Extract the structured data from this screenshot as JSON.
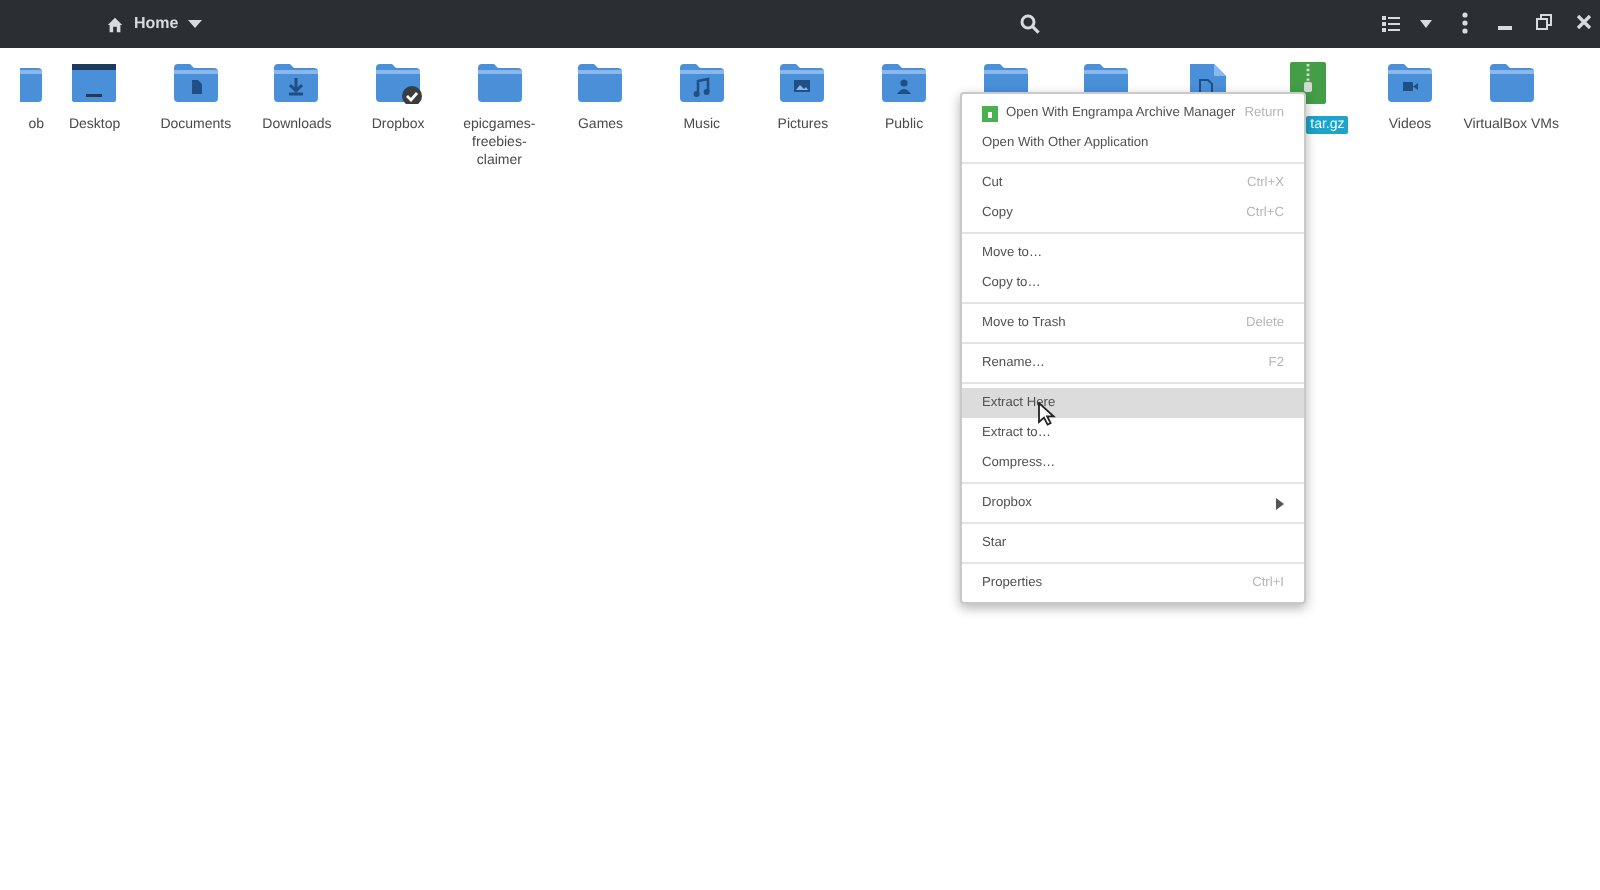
{
  "header": {
    "location": "Home"
  },
  "files": [
    {
      "name": "ob",
      "kind": "partial",
      "selected": false
    },
    {
      "name": "Desktop",
      "kind": "desktop",
      "selected": false
    },
    {
      "name": "Documents",
      "kind": "documents",
      "selected": false
    },
    {
      "name": "Downloads",
      "kind": "downloads",
      "selected": false
    },
    {
      "name": "Dropbox",
      "kind": "dropbox",
      "selected": false
    },
    {
      "name": "epicgames-freebies-claimer",
      "kind": "plain",
      "selected": false
    },
    {
      "name": "Games",
      "kind": "plain",
      "selected": false
    },
    {
      "name": "Music",
      "kind": "music",
      "selected": false
    },
    {
      "name": "Pictures",
      "kind": "pictures",
      "selected": false
    },
    {
      "name": "Public",
      "kind": "public",
      "selected": false
    },
    {
      "kind": "plain",
      "selected": false
    },
    {
      "kind": "plain",
      "selected": false
    },
    {
      "kind": "file",
      "selected": false
    },
    {
      "name": "tar.gz",
      "kind": "archive",
      "selected": true
    },
    {
      "name": "Videos",
      "kind": "videos",
      "selected": false
    },
    {
      "name": "VirtualBox VMs",
      "kind": "plain",
      "selected": false
    }
  ],
  "context_menu": {
    "groups": [
      [
        {
          "label": "Open With Engrampa Archive Manager",
          "shortcut": "Return",
          "kind": "app",
          "selected": false
        },
        {
          "label": "Open With Other Application",
          "kind": "plain",
          "selected": false
        }
      ],
      [
        {
          "label": "Cut",
          "shortcut": "Ctrl+X",
          "kind": "plain",
          "selected": false
        },
        {
          "label": "Copy",
          "shortcut": "Ctrl+C",
          "kind": "plain",
          "selected": false
        }
      ],
      [
        {
          "label": "Move to…",
          "kind": "plain",
          "selected": false
        },
        {
          "label": "Copy to…",
          "kind": "plain",
          "selected": false
        }
      ],
      [
        {
          "label": "Move to Trash",
          "shortcut": "Delete",
          "kind": "plain",
          "selected": false
        }
      ],
      [
        {
          "label": "Rename…",
          "shortcut": "F2",
          "kind": "plain",
          "selected": false
        }
      ],
      [
        {
          "label": "Extract Here",
          "kind": "plain",
          "selected": true
        },
        {
          "label": "Extract to…",
          "kind": "plain",
          "selected": false
        },
        {
          "label": "Compress…",
          "kind": "plain",
          "selected": false
        }
      ],
      [
        {
          "label": "Dropbox",
          "kind": "submenu",
          "selected": false
        }
      ],
      [
        {
          "label": "Star",
          "kind": "plain",
          "selected": false
        }
      ],
      [
        {
          "label": "Properties",
          "shortcut": "Ctrl+I",
          "kind": "plain",
          "selected": false
        }
      ]
    ]
  }
}
